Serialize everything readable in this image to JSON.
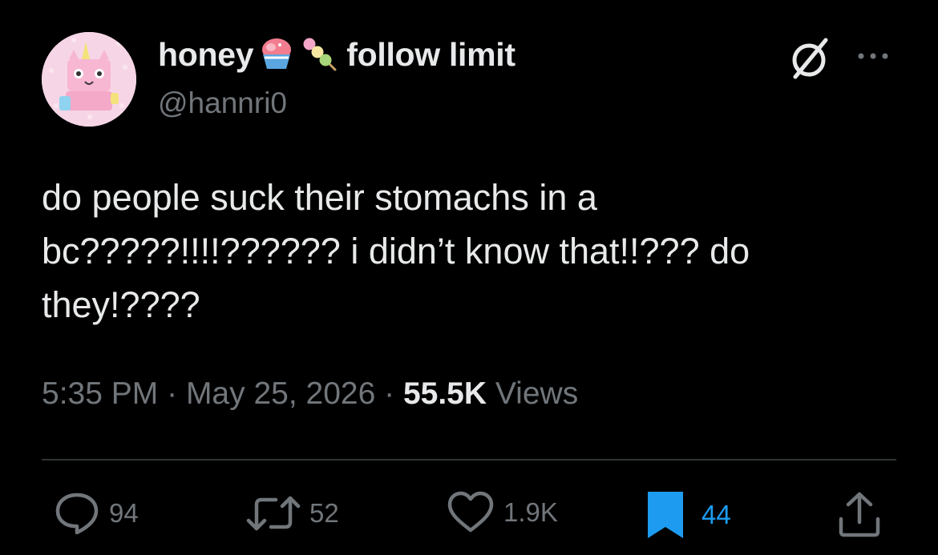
{
  "tweet": {
    "author": {
      "display_name": "honey",
      "bio_suffix": "follow limit",
      "handle": "@hannri0",
      "avatar_icon": "unikitty-avatar"
    },
    "text_lines": [
      "do people suck their stomachs in a",
      "bc?????!!!!?????? i didn’t know that!!??? do",
      "they!????"
    ],
    "time": "5:35 PM",
    "date": "May 25, 2026",
    "views_count": "55.5K",
    "views_label": "Views",
    "separator": "·",
    "actions": {
      "replies": "94",
      "reposts": "52",
      "likes": "1.9K",
      "bookmarks": "44"
    },
    "icons": {
      "name_emoji_1": "shaved-ice-emoji",
      "name_emoji_2": "dango-emoji",
      "badge": "empty-set-icon",
      "more": "more-icon",
      "reply": "reply-icon",
      "repost": "repost-icon",
      "like": "heart-icon",
      "bookmark": "bookmark-icon",
      "share": "share-icon"
    },
    "colors": {
      "background": "#000000",
      "text": "#e7e9ea",
      "muted": "#71767b",
      "accent": "#1d9bf0"
    }
  }
}
